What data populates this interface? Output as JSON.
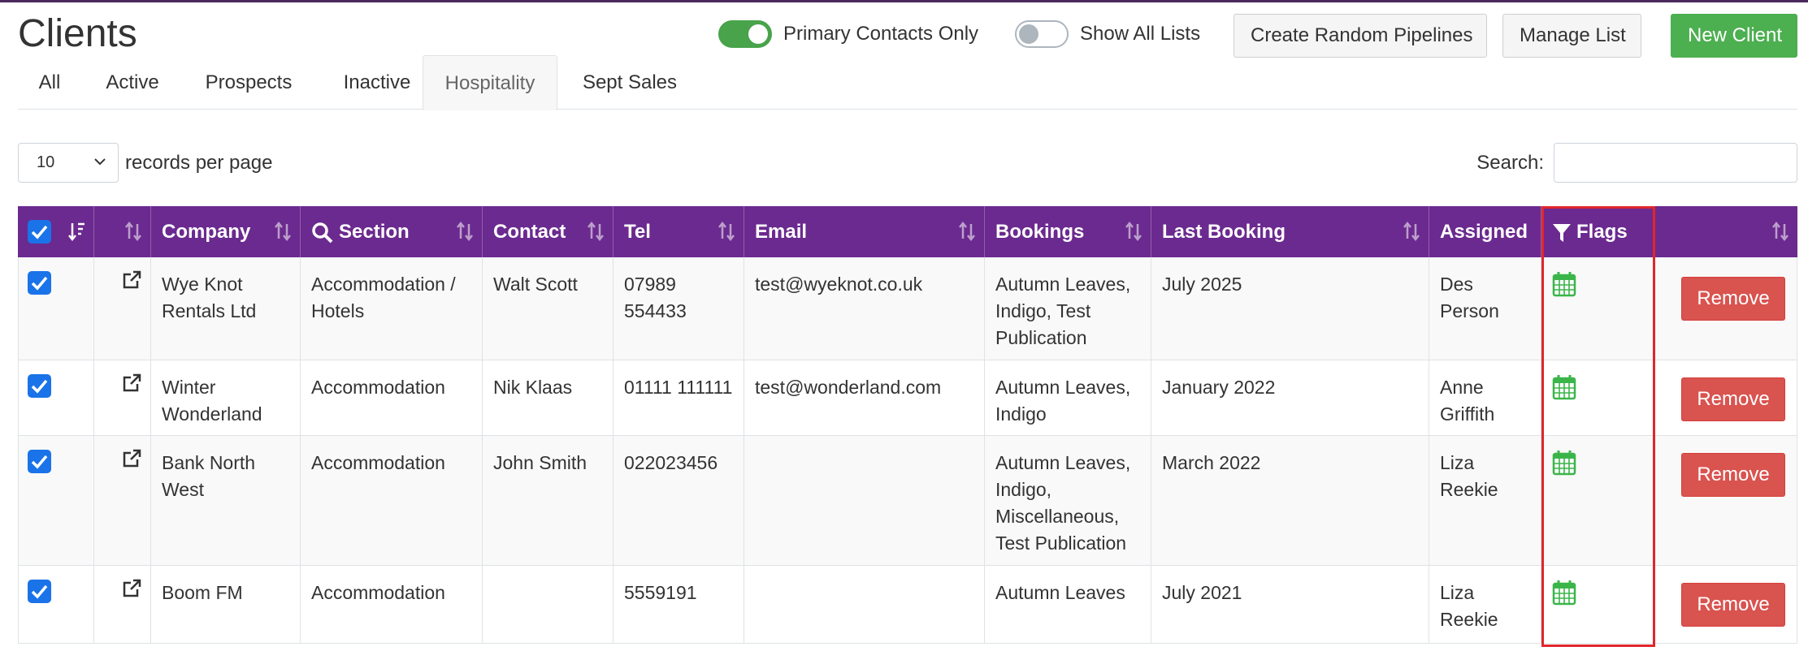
{
  "page": {
    "title": "Clients"
  },
  "toggles": {
    "primary_contacts": {
      "label": "Primary Contacts Only",
      "on": true
    },
    "show_all_lists": {
      "label": "Show All Lists",
      "on": false
    }
  },
  "buttons": {
    "create_random_pipelines": "Create Random Pipelines",
    "manage_list": "Manage List",
    "new_client": "New Client"
  },
  "tabs": [
    {
      "label": "All"
    },
    {
      "label": "Active"
    },
    {
      "label": "Prospects"
    },
    {
      "label": "Inactive"
    },
    {
      "label": "Hospitality",
      "active": true
    },
    {
      "label": "Sept Sales"
    }
  ],
  "controls": {
    "per_page_value": "10",
    "per_page_label": "records per page",
    "search_label": "Search:",
    "search_value": ""
  },
  "table": {
    "headers": {
      "company": "Company",
      "section": "Section",
      "contact": "Contact",
      "tel": "Tel",
      "email": "Email",
      "bookings": "Bookings",
      "last_booking": "Last Booking",
      "assigned": "Assigned",
      "flags": "Flags"
    },
    "remove_label": "Remove",
    "rows": [
      {
        "checked": true,
        "company": "Wye Knot Rentals Ltd",
        "section": "Accommodation / Hotels",
        "contact": "Walt Scott",
        "tel": "07989 554433",
        "email": "test@wyeknot.co.uk",
        "bookings": "Autumn Leaves, Indigo, Test Publication",
        "last_booking": "July 2025",
        "assigned": "Des Person",
        "flag": "calendar-icon"
      },
      {
        "checked": true,
        "company": "Winter Wonderland",
        "section": "Accommodation",
        "contact": "Nik Klaas",
        "tel": "01111 111111",
        "email": "test@wonderland.com",
        "bookings": "Autumn Leaves, Indigo",
        "last_booking": "January 2022",
        "assigned": "Anne Griffith",
        "flag": "calendar-icon"
      },
      {
        "checked": true,
        "company": "Bank North West",
        "section": "Accommodation",
        "contact": "John Smith",
        "tel": "022023456",
        "email": "",
        "bookings": "Autumn Leaves, Indigo, Miscellaneous, Test Publication",
        "last_booking": "March 2022",
        "assigned": "Liza Reekie",
        "flag": "calendar-icon"
      },
      {
        "checked": true,
        "company": "Boom FM",
        "section": "Accommodation",
        "contact": "",
        "tel": "5559191",
        "email": "",
        "bookings": "Autumn Leaves",
        "last_booking": "July 2021",
        "assigned": "Liza Reekie",
        "flag": "calendar-icon"
      }
    ]
  },
  "colors": {
    "header_bg": "#6b2a8f",
    "toggle_on": "#48a34a",
    "new_client": "#4caf50",
    "remove": "#d9534f",
    "checkbox": "#1a73e8",
    "flag_icon": "#3bb54a",
    "highlight": "#e0262b"
  }
}
